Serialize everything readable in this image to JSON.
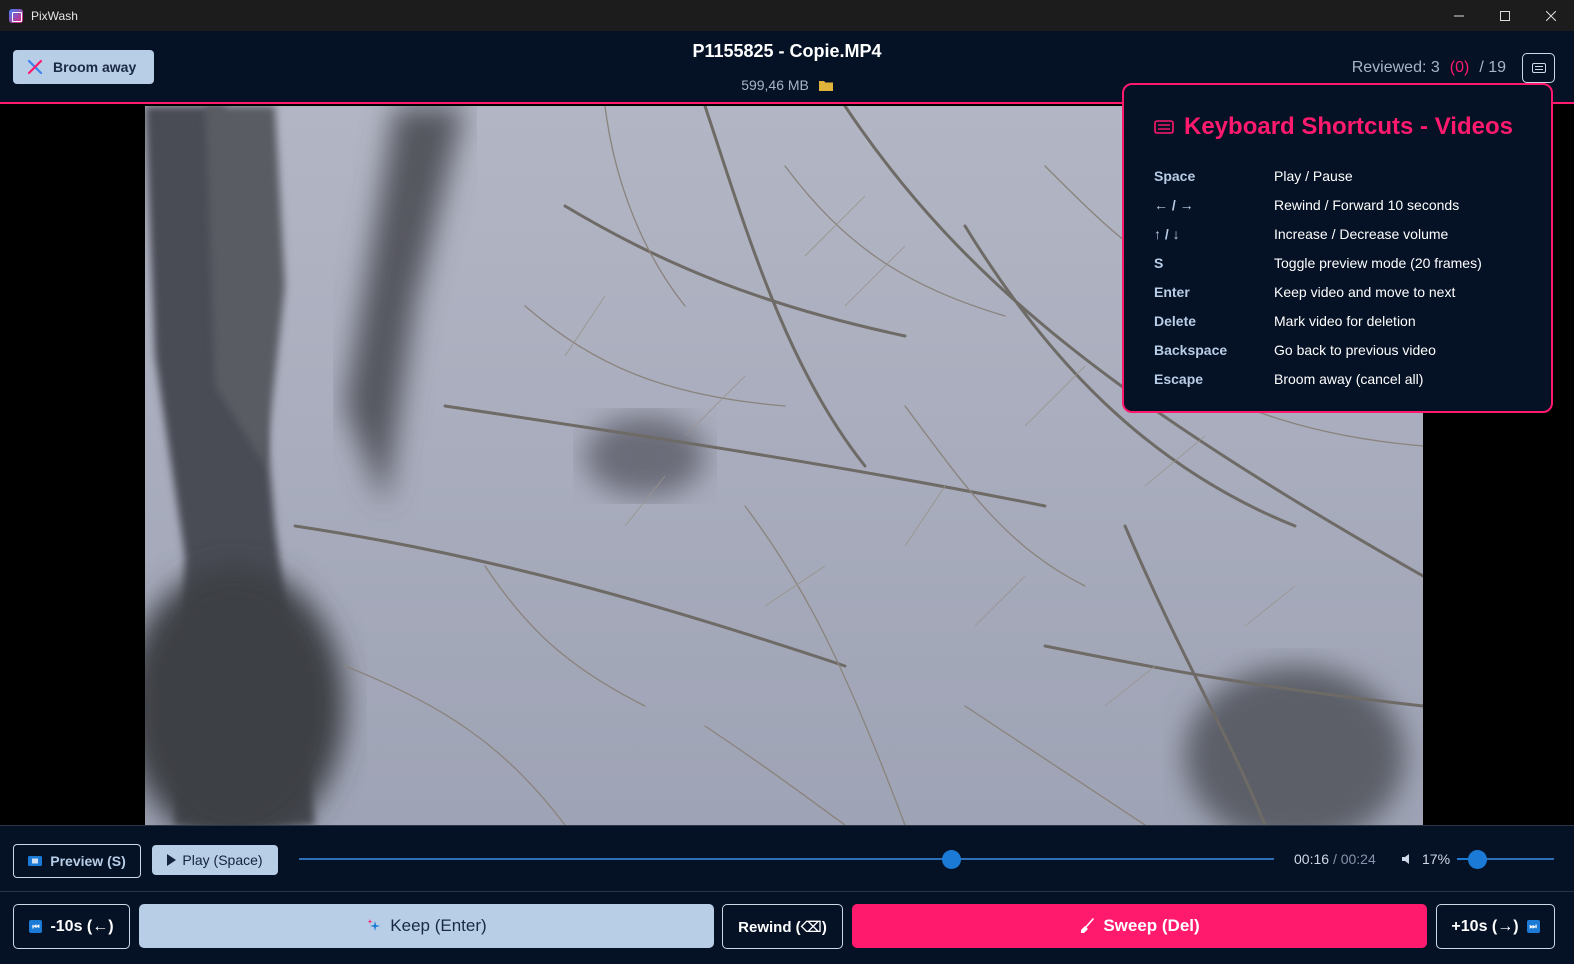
{
  "window": {
    "app_title": "PixWash",
    "controls": {
      "minimize": "—",
      "maximize": "☐",
      "close": "✕"
    }
  },
  "header": {
    "broom_away_label": "Broom away",
    "file_name": "P1155825 - Copie.MP4",
    "file_size": "599,46 MB",
    "reviewed_label": "Reviewed: 3",
    "reviewed_marked": "(0)",
    "reviewed_total": "/ 19"
  },
  "shortcuts": {
    "title": "Keyboard Shortcuts - Videos",
    "items": [
      {
        "key": "Space",
        "desc": "Play / Pause"
      },
      {
        "key": "← / →",
        "desc": "Rewind / Forward 10 seconds"
      },
      {
        "key": "↑ / ↓",
        "desc": "Increase / Decrease volume"
      },
      {
        "key": "S",
        "desc": "Toggle preview mode (20 frames)"
      },
      {
        "key": "Enter",
        "desc": "Keep video and move to next"
      },
      {
        "key": "Delete",
        "desc": "Mark video for deletion"
      },
      {
        "key": "Backspace",
        "desc": "Go back to previous video"
      },
      {
        "key": "Escape",
        "desc": "Broom away (cancel all)"
      }
    ]
  },
  "controls": {
    "preview_label": "Preview (S)",
    "play_label": "Play (Space)",
    "current_time": "00:16",
    "total_time": "/ 00:24",
    "seek_progress": 0.667,
    "volume_label": "17%",
    "volume_level": 0.17
  },
  "actions": {
    "back_label": "-10s (←)",
    "keep_label": "Keep (Enter)",
    "rewind_label": "Rewind (⌫)",
    "sweep_label": "Sweep (Del)",
    "forward_label": "+10s (→)"
  },
  "colors": {
    "accent": "#ff1a6e",
    "header_bg": "#051125",
    "button_light": "#b8cde6",
    "slider": "#1a7ad6"
  }
}
